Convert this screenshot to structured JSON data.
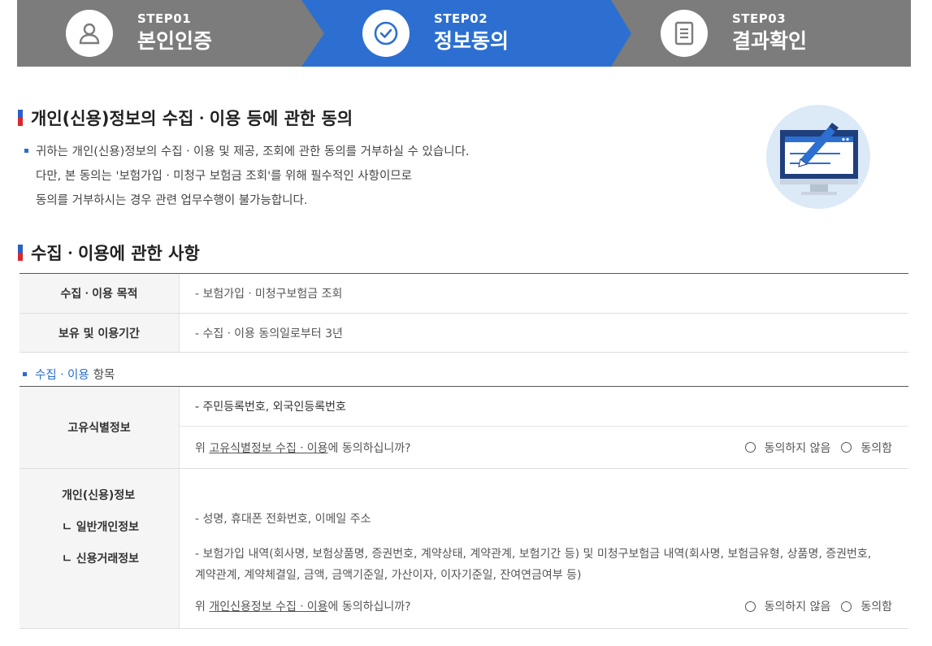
{
  "steps": [
    {
      "num": "STEP01",
      "title": "본인인증",
      "icon": "user-icon"
    },
    {
      "num": "STEP02",
      "title": "정보동의",
      "icon": "check-circle-icon"
    },
    {
      "num": "STEP03",
      "title": "결과확인",
      "icon": "document-icon"
    }
  ],
  "colors": {
    "step_bg": "#7c7c7c",
    "step_active": "#2c6fd1",
    "accent_blue": "#2a6cd0",
    "accent_red": "#d9272e"
  },
  "consent": {
    "title": "개인(신용)정보의 수집ㆍ이용 등에 관한 동의",
    "intro_line1": "귀하는 개인(신용)정보의 수집ㆍ이용 및 제공, 조회에 관한 동의를 거부하실 수 있습니다.",
    "intro_line2": "다만, 본 동의는 '보험가입ㆍ미청구 보험금 조회'를 위해 필수적인 사항이므로",
    "intro_line3": "동의를 거부하시는 경우 관련 업무수행이 불가능합니다."
  },
  "collection": {
    "title": "수집ㆍ이용에 관한 사항",
    "rows": [
      {
        "label": "수집ㆍ이용 목적",
        "value": "- 보험가입ㆍ미청구보험금 조회"
      },
      {
        "label": "보유 및 이용기간",
        "value": "- 수집ㆍ이용 동의일로부터 3년"
      }
    ]
  },
  "items": {
    "title_blue": "수집ㆍ이용",
    "title_gray": "항목",
    "unique": {
      "label": "고유식별정보",
      "value": "- 주민등록번호, 외국인등록번호",
      "q_prefix": "위 ",
      "q_link": "고유식별정보 수집ㆍ이용",
      "q_suffix": "에 동의하십니까?"
    },
    "personal": {
      "label": "개인(신용)정보",
      "sub1": "ㄴ 일반개인정보",
      "sub2": "ㄴ 신용거래정보",
      "value1": "- 성명, 휴대폰 전화번호, 이메일 주소",
      "value2a": "- 보험가입 내역(회사명, 보험상품명, 증권번호, 계약상태, 계약관계, 보험기간 등) 및 미청구보험금 내역(회사명, 보험금유형, 상품명, 증권번호,",
      "value2b": "계약관계, 계약체결일, 금액, 금액기준일, 가산이자, 이자기준일, 잔여연금여부 등)",
      "q_prefix": "위 ",
      "q_link": "개인신용정보 수집ㆍ이용",
      "q_suffix": "에 동의하십니까?"
    },
    "disagree_label": "동의하지 않음",
    "agree_label": "동의함"
  }
}
